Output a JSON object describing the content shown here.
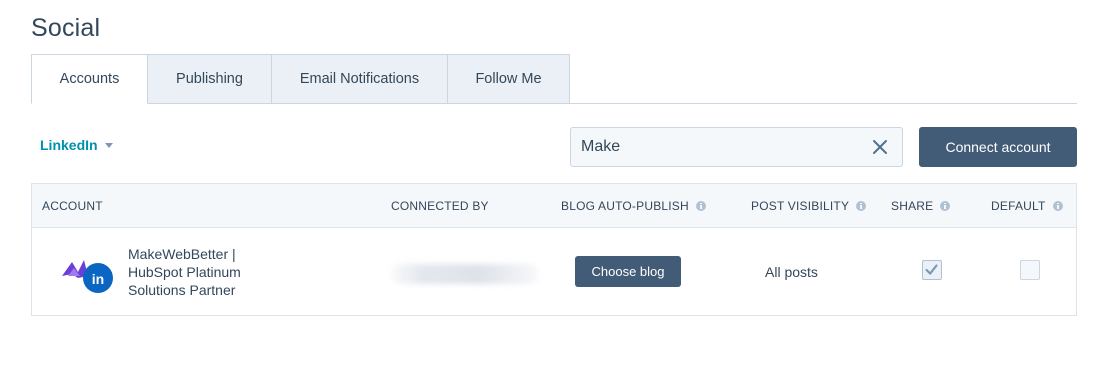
{
  "page": {
    "title": "Social"
  },
  "tabs": [
    {
      "label": "Accounts",
      "active": true
    },
    {
      "label": "Publishing",
      "active": false
    },
    {
      "label": "Email Notifications",
      "active": false
    },
    {
      "label": "Follow Me",
      "active": false
    }
  ],
  "toolbar": {
    "network_filter": "LinkedIn",
    "search_value": "Make",
    "connect_label": "Connect account"
  },
  "table": {
    "columns": {
      "account": "ACCOUNT",
      "connected_by": "CONNECTED BY",
      "blog_auto_publish": "BLOG AUTO-PUBLISH",
      "post_visibility": "POST VISIBILITY",
      "share": "SHARE",
      "default": "DEFAULT"
    },
    "rows": [
      {
        "account_name": "MakeWebBetter | HubSpot Platinum Solutions Partner",
        "network_badge": "in",
        "blog_button": "Choose blog",
        "post_visibility": "All posts",
        "share_checked": true,
        "default_checked": false
      }
    ]
  },
  "colors": {
    "accent": "#0091ae",
    "button_dark": "#425b76",
    "linkedin": "#0a66c2",
    "logo_purple": "#6b3fd6"
  }
}
